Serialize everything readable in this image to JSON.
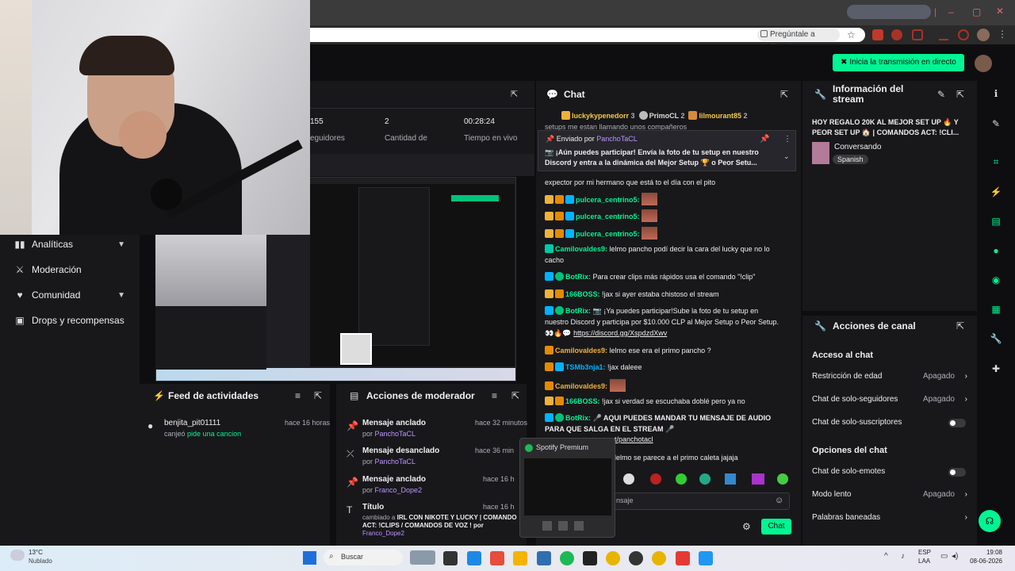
{
  "browser": {
    "omnibox_hint": "Pregúntale a Google"
  },
  "header": {
    "live_button": "Inicia la transmisión en directo"
  },
  "sidebar": {
    "items": [
      {
        "label": "Analíticas",
        "has_chevron": true
      },
      {
        "label": "Moderación",
        "has_chevron": false
      },
      {
        "label": "Comunidad",
        "has_chevron": true
      },
      {
        "label": "Drops y recompensas",
        "has_chevron": false
      }
    ]
  },
  "stats": {
    "followers_value": "155",
    "followers_label": "eguidores",
    "subs_value": "2",
    "subs_label": "Cantidad de",
    "time_value": "00:28:24",
    "time_label": "Tiempo en vivo"
  },
  "activity_feed": {
    "title": "Feed de actividades",
    "items": [
      {
        "user": "benjita_pit01111",
        "time": "hace 16 horas",
        "action": "canjeó",
        "reward": "pide una cancion"
      }
    ]
  },
  "mod_actions": {
    "title": "Acciones de moderador",
    "items": [
      {
        "action": "Mensaje anclado",
        "time": "hace 32 minutos",
        "by": "por",
        "user": "PanchoTaCL"
      },
      {
        "action": "Mensaje desanclado",
        "time": "hace 36 min",
        "by": "por",
        "user": "PanchoTaCL"
      },
      {
        "action": "Mensaje anclado",
        "time": "hace 16 h",
        "by": "por",
        "user": "Franco_Dope2"
      },
      {
        "action": "Título",
        "time": "hace 16 h",
        "detail_prefix": "cambiado a",
        "detail": "IRL CON NIKOTE Y LUCKY | COMANDO ACT: !CLIPS / COMANDOS DE VOZ ! por",
        "user": "Franco_Dope2"
      }
    ]
  },
  "chat": {
    "title": "Chat",
    "top_users": [
      {
        "name": "luckykypenedorr",
        "count": "3"
      },
      {
        "name": "PrimoCL",
        "count": "2"
      },
      {
        "name": "lilmourant85",
        "count": "2"
      }
    ],
    "behind_pin_text": "setups me estan llamando unos compañeros",
    "pinned": {
      "sent_by_label": "Enviado por",
      "sent_by_user": "PanchoTaCL",
      "text": "📷 ¡Aún puedes participar! Envía la foto de tu setup en nuestro Discord y entra a la dinámica del Mejor Setup 🏆 o Peor Setu..."
    },
    "messages": [
      {
        "user": "",
        "text": "expector por mi hermano que está to el día con el pito",
        "color": "#efeff1"
      },
      {
        "user": "pulcera_centrino5:",
        "text": "",
        "color": "#00f593"
      },
      {
        "user": "pulcera_centrino5:",
        "text": "",
        "color": "#00f593"
      },
      {
        "user": "pulcera_centrino5:",
        "text": "",
        "color": "#00f593"
      },
      {
        "user": "Camilovaldes9:",
        "text": "lelmo pancho podí decir la cara del lucky que no lo cacho",
        "color": "#00f593"
      },
      {
        "user": "BotRix:",
        "text": "Para crear clips más rápidos usa el comando \"!clip\"",
        "color": "#00f593"
      },
      {
        "user": "166BOSS:",
        "text": "!jax si ayer estaba chistoso el stream",
        "color": "#00f593"
      },
      {
        "user": "BotRix:",
        "text": "📷 ¡Ya puedes participar!Sube la foto de tu setup en nuestro Discord y participa por $10.000 CLP al Mejor Setup o Peor Setup. 👀🔥💬",
        "link": "https://discord.gg/XspdzdXwv",
        "color": "#00f593"
      },
      {
        "user": "Camilovaldes9:",
        "text": "lelmo ese era el primo pancho ?",
        "color": "#f0b23a"
      },
      {
        "user": "TSMb3nja1:",
        "text": "!jax daleee",
        "color": "#00b3ff"
      },
      {
        "user": "Camilovaldes9:",
        "text": "",
        "color": "#f0b23a"
      },
      {
        "user": "166BOSS:",
        "text": "!jax si verdad se escuchaba doblé pero ya no",
        "color": "#00f593"
      },
      {
        "user": "BotRix:",
        "text": "🎤 AQUI PUEDES MANDAR TU MENSAJE DE AUDIO PARA QUE SALGA EN EL STREAM 🎤",
        "link": "t/panchotacl",
        "color": "#00f593"
      },
      {
        "user": "",
        "text": "lelmo se parece a el primo caleta jajaja",
        "color": "#efeff1"
      }
    ],
    "input_placeholder": "nsaje",
    "send_button": "Chat"
  },
  "stream_info": {
    "title": "Información del stream",
    "stream_title": "HOY REGALO 20K AL MEJOR SET UP 🔥 Y PEOR SET UP 🏠 | COMANDOS ACT: !CLI...",
    "category": "Conversando",
    "language": "Spanish"
  },
  "channel_actions": {
    "title": "Acciones de canal",
    "access_heading": "Acceso al chat",
    "rows": [
      {
        "label": "Restricción de edad",
        "value": "Apagado",
        "kind": "arrow"
      },
      {
        "label": "Chat de solo-seguidores",
        "value": "Apagado",
        "kind": "arrow"
      },
      {
        "label": "Chat de solo-suscriptores",
        "value": "",
        "kind": "toggle"
      }
    ],
    "options_heading": "Opciones del chat",
    "option_rows": [
      {
        "label": "Chat de solo-emotes",
        "value": "",
        "kind": "toggle"
      },
      {
        "label": "Modo lento",
        "value": "Apagado",
        "kind": "arrow"
      },
      {
        "label": "Palabras baneadas",
        "value": "",
        "kind": "arrow"
      }
    ]
  },
  "spotify": {
    "label": "Spotify Premium"
  },
  "taskbar": {
    "weather_temp": "13°C",
    "weather_desc": "Nublado",
    "search_label": "Buscar",
    "lang": "ESP",
    "lang_sub": "LAA",
    "time": "19:08",
    "date": "08-06-2026"
  }
}
